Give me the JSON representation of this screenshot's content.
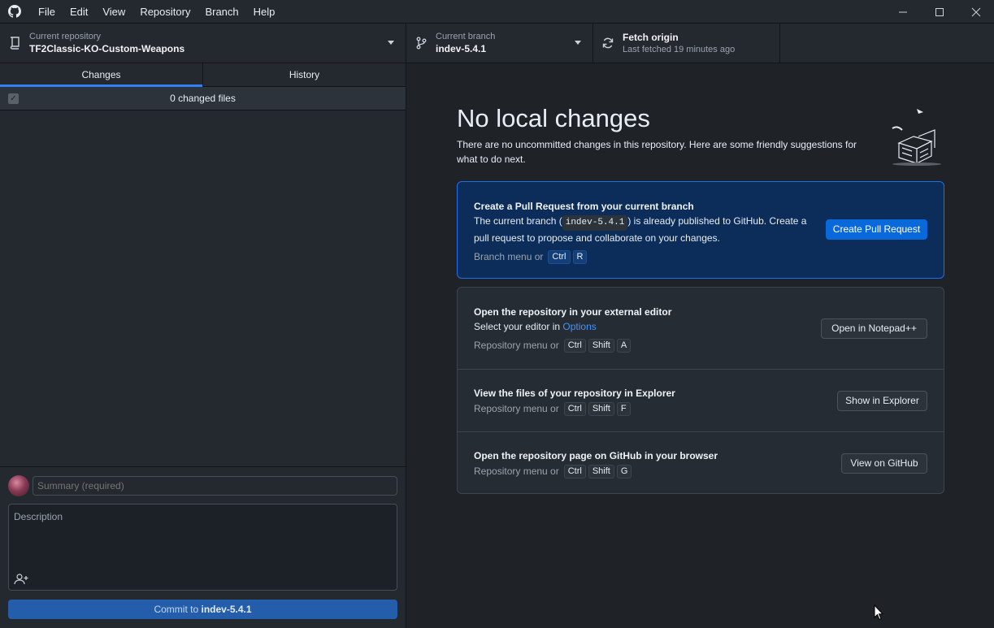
{
  "menu": [
    "File",
    "Edit",
    "View",
    "Repository",
    "Branch",
    "Help"
  ],
  "toolbar": {
    "repo_label": "Current repository",
    "repo_value": "TF2Classic-KO-Custom-Weapons",
    "branch_label": "Current branch",
    "branch_value": "indev-5.4.1",
    "fetch_title": "Fetch origin",
    "fetch_sub": "Last fetched 19 minutes ago"
  },
  "tabs": {
    "changes": "Changes",
    "history": "History"
  },
  "changes_header": "0 changed files",
  "commit": {
    "summary_placeholder": "Summary (required)",
    "description_placeholder": "Description",
    "button_prefix": "Commit to ",
    "button_branch": "indev-5.4.1"
  },
  "main": {
    "heading": "No local changes",
    "subtext": "There are no uncommitted changes in this repository. Here are some friendly suggestions for what to do next.",
    "pr_card": {
      "title": "Create a Pull Request from your current branch",
      "desc_before": "The current branch (",
      "branch_chip": "indev-5.4.1",
      "desc_after": ") is already published to GitHub. Create a pull request to propose and collaborate on your changes.",
      "hint_prefix": "Branch menu or",
      "keys": [
        "Ctrl",
        "R"
      ],
      "button": "Create Pull Request"
    },
    "editor_row": {
      "title": "Open the repository in your external editor",
      "desc_prefix": "Select your editor in ",
      "desc_link": "Options",
      "hint_prefix": "Repository menu or",
      "keys": [
        "Ctrl",
        "Shift",
        "A"
      ],
      "button": "Open in Notepad++"
    },
    "explorer_row": {
      "title": "View the files of your repository in Explorer",
      "hint_prefix": "Repository menu or",
      "keys": [
        "Ctrl",
        "Shift",
        "F"
      ],
      "button": "Show in Explorer"
    },
    "github_row": {
      "title": "Open the repository page on GitHub in your browser",
      "hint_prefix": "Repository menu or",
      "keys": [
        "Ctrl",
        "Shift",
        "G"
      ],
      "button": "View on GitHub"
    }
  },
  "colors": {
    "accent": "#2f81f7",
    "pr_card_bg": "#0c2d5a",
    "primary_button": "#0969da",
    "commit_button": "#245eaa"
  }
}
